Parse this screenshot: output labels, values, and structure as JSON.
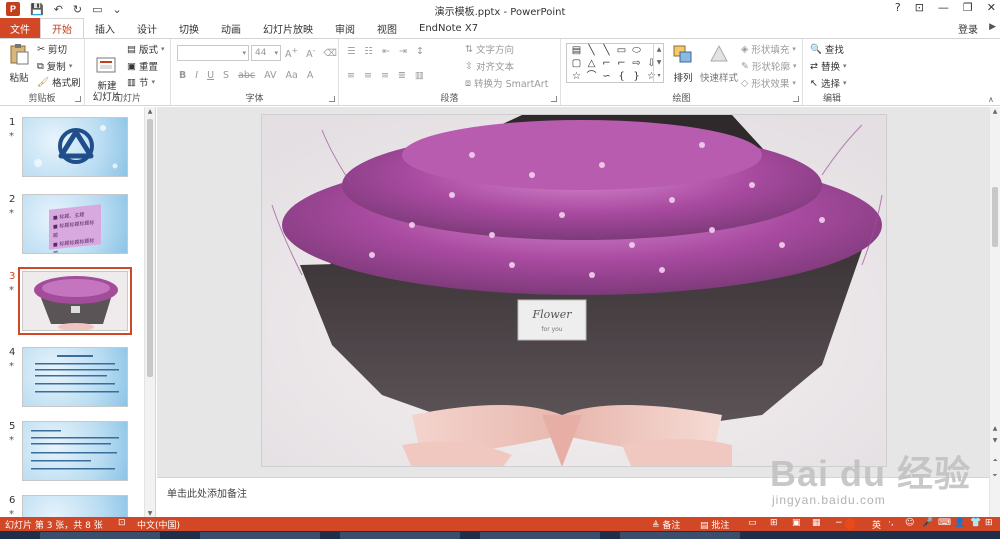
{
  "window": {
    "title": "演示模板.pptx - PowerPoint"
  },
  "window_controls": {
    "help": "?",
    "ribbon_display": "⊡",
    "minimize": "—",
    "restore": "❐",
    "close": "✕"
  },
  "tabs": [
    "文件",
    "开始",
    "插入",
    "设计",
    "切换",
    "动画",
    "幻灯片放映",
    "审阅",
    "视图",
    "EndNote X7"
  ],
  "active_tab": "开始",
  "login_label": "登录",
  "ribbon": {
    "clipboard": {
      "label": "剪贴板",
      "paste": "粘贴",
      "cut": "剪切",
      "copy": "复制",
      "format_painter": "格式刷"
    },
    "slides": {
      "label": "幻灯片",
      "new_slide": "新建\n幻灯片",
      "layout": "版式",
      "reset": "重置",
      "section": "节"
    },
    "font": {
      "label": "字体",
      "font_size": "44"
    },
    "paragraph": {
      "label": "段落",
      "text_direction": "文字方向",
      "align_text": "对齐文本",
      "convert_smartart": "转换为 SmartArt"
    },
    "drawing": {
      "label": "绘图",
      "arrange": "排列",
      "quick_styles": "快速样式",
      "shape_fill": "形状填充",
      "shape_outline": "形状轮廓",
      "shape_effects": "形状效果"
    },
    "editing": {
      "label": "编辑",
      "find": "查找",
      "replace": "替换",
      "select": "选择"
    }
  },
  "slides": [
    {
      "number": "1",
      "star": "*"
    },
    {
      "number": "2",
      "star": "*"
    },
    {
      "number": "3",
      "star": "*"
    },
    {
      "number": "4",
      "star": "*"
    },
    {
      "number": "5",
      "star": "*"
    },
    {
      "number": "6",
      "star": "*"
    }
  ],
  "selected_slide": 3,
  "slide2_bullets": [
    "■ 标题、主题",
    "■ 标题标题标题标题",
    "■ 标题标题标题标题"
  ],
  "slide3_tag": {
    "line1": "Flower",
    "line2": "for you"
  },
  "notes_placeholder": "单击此处添加备注",
  "status": {
    "slide_info": "幻灯片 第 3 张，共 8 张",
    "language": "中文(中国)",
    "notes": "备注",
    "comments": "批注",
    "ime": "英"
  },
  "watermark": {
    "brand": "Bai du 经验",
    "url": "jingyan.baidu.com"
  },
  "colors": {
    "accent": "#d24726",
    "status_bar": "#d24726"
  }
}
